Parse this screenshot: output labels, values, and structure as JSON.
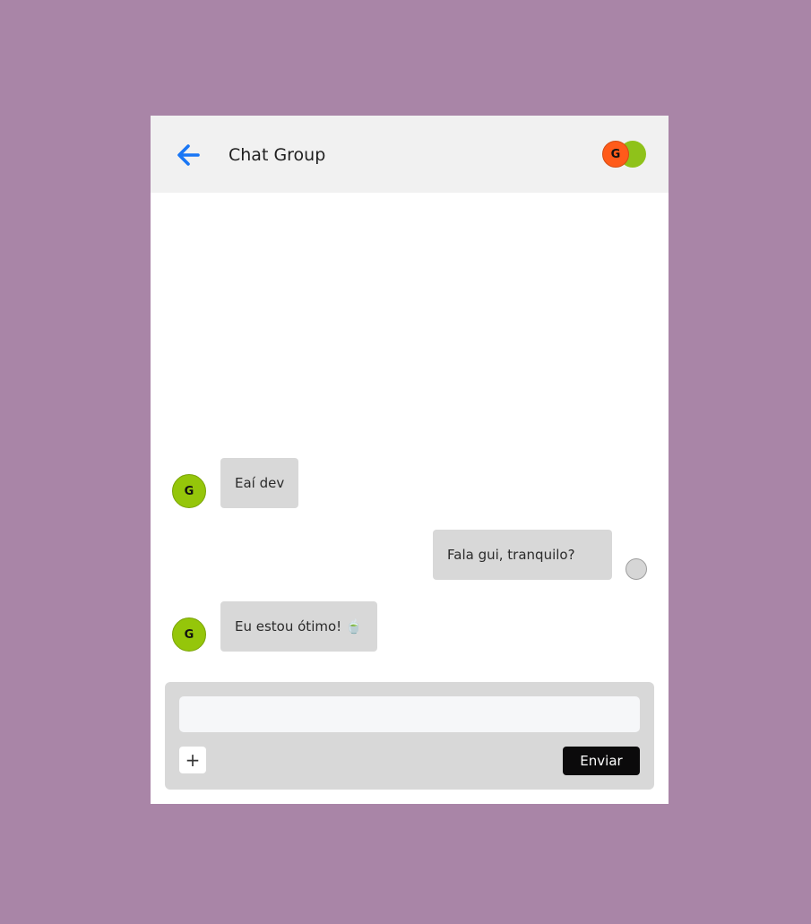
{
  "header": {
    "title": "Chat Group",
    "participants": [
      {
        "initial": "G",
        "color": "#ff5b1a"
      },
      {
        "initial": "",
        "color": "#8fc21a"
      }
    ]
  },
  "messages": [
    {
      "sender": "other",
      "avatar_initial": "G",
      "text": "Eaí dev"
    },
    {
      "sender": "me",
      "avatar_initial": "",
      "text": "Fala gui, tranquilo?"
    },
    {
      "sender": "other",
      "avatar_initial": "G",
      "text": "Eu estou ótimo! 🍵"
    }
  ],
  "composer": {
    "input_value": "",
    "input_placeholder": "",
    "attach_label": "+",
    "send_label": "Enviar"
  },
  "colors": {
    "page_background": "#a985a7",
    "header_background": "#f1f1f1",
    "accent_back_arrow": "#1976f5",
    "bubble_background": "#d8d8d8",
    "send_button": "#0b0a0b"
  }
}
